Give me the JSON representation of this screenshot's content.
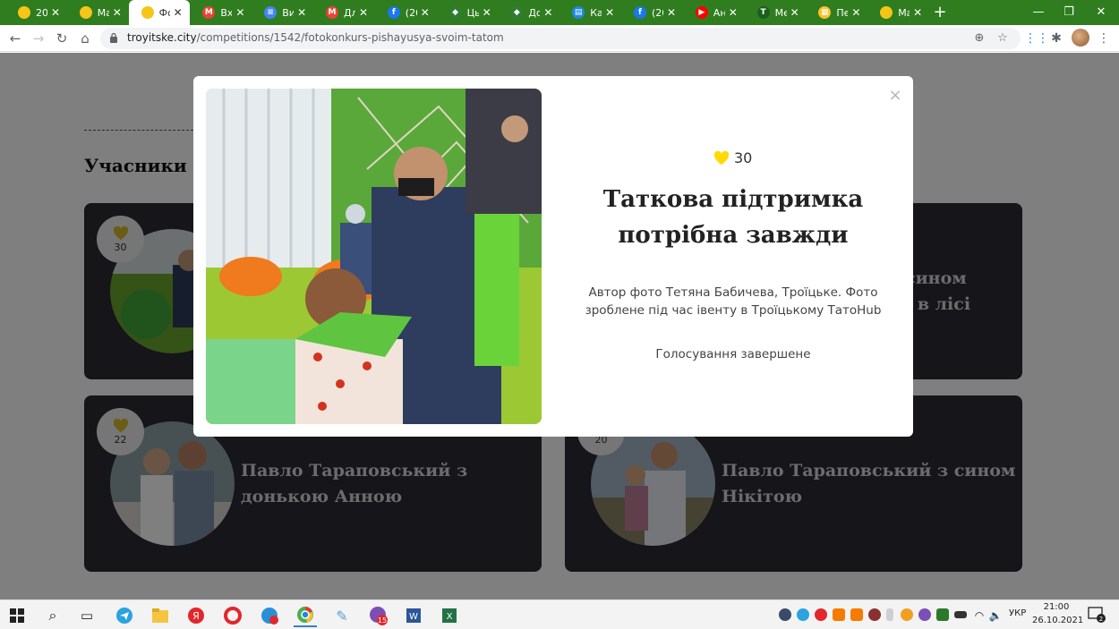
{
  "browser": {
    "tabs": [
      {
        "label": "20 ",
        "favicon_color": "#f5c518",
        "favicon_glyph": ""
      },
      {
        "label": "Ма",
        "favicon_color": "#f5c518",
        "favicon_glyph": ""
      },
      {
        "label": "Фот",
        "favicon_color": "#f5c518",
        "favicon_glyph": "",
        "active": true
      },
      {
        "label": "Вхо",
        "favicon_color": "#ea4335",
        "favicon_glyph": "M"
      },
      {
        "label": "Виз",
        "favicon_color": "#4285f4",
        "favicon_glyph": "≡"
      },
      {
        "label": "Дл",
        "favicon_color": "#ea4335",
        "favicon_glyph": "M"
      },
      {
        "label": "(20",
        "favicon_color": "#1877f2",
        "favicon_glyph": "f"
      },
      {
        "label": "Цьс",
        "favicon_color": "#2e7d32",
        "favicon_glyph": "◆"
      },
      {
        "label": "До",
        "favicon_color": "#2e7d32",
        "favicon_glyph": "◆"
      },
      {
        "label": "Как",
        "favicon_color": "#1e88e5",
        "favicon_glyph": "▤"
      },
      {
        "label": "(20",
        "favicon_color": "#1877f2",
        "favicon_glyph": "f"
      },
      {
        "label": "Анс",
        "favicon_color": "#ff0000",
        "favicon_glyph": "▶"
      },
      {
        "label": "Ме",
        "favicon_color": "#1b5e20",
        "favicon_glyph": "T"
      },
      {
        "label": "Пер",
        "favicon_color": "#fbc02d",
        "favicon_glyph": "▦"
      },
      {
        "label": "Ма",
        "favicon_color": "#f5c518",
        "favicon_glyph": ""
      }
    ],
    "url_host": "troyitske.city",
    "url_path": "/competitions/1542/fotokonkurs-pishayusya-svoim-tatom",
    "controls": {
      "minimize": "—",
      "restore": "❐",
      "close": "✕",
      "new_tab": "+"
    }
  },
  "page": {
    "section_title": "Учасники",
    "cards": [
      {
        "likes": "30",
        "title": ""
      },
      {
        "likes": "",
        "title": "сином\n і в лісі"
      },
      {
        "likes": "22",
        "title": "Павло Тараповський з донькою Анною"
      },
      {
        "likes": "20",
        "title": "Павло Тараповський з сином Нікітою"
      }
    ]
  },
  "modal": {
    "likes": "30",
    "title": "Таткова підтримка потрібна завжди",
    "description": "Автор фото Тетяна Бабичева, Троїцьке. Фото зроблене під час івенту в Троїцькому ТатоHub",
    "status": "Голосування завершене",
    "close_symbol": "×",
    "heart_color": "#ffd900"
  },
  "taskbar": {
    "language": "УКР",
    "time": "21:00",
    "date": "26.10.2021",
    "notification_count": "2",
    "badge_viber": "15"
  }
}
